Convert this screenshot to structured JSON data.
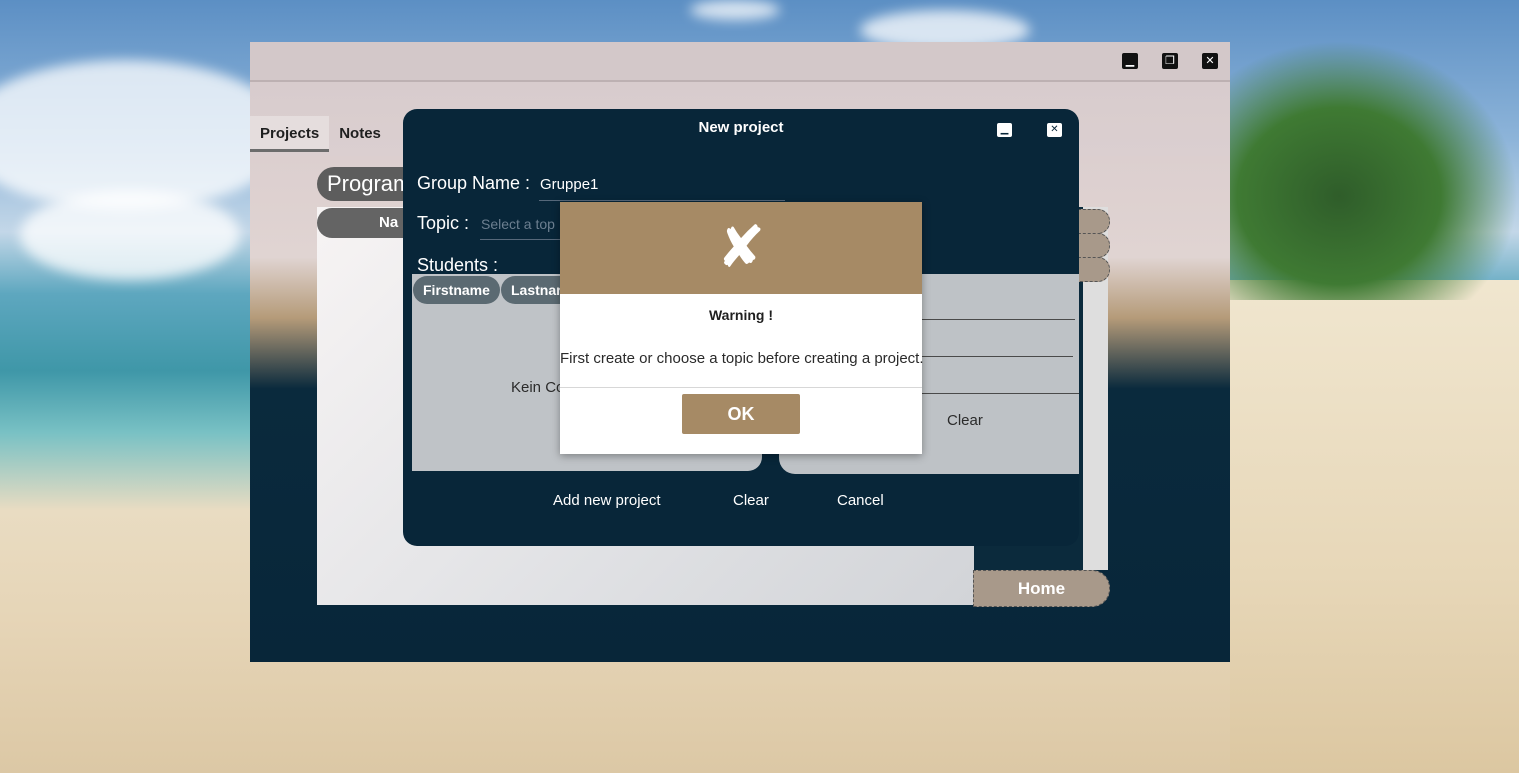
{
  "app": {
    "tabs": [
      {
        "label": "Projects",
        "active": true
      },
      {
        "label": "Notes",
        "active": false
      }
    ],
    "page_title": "Program",
    "column_header": "Na",
    "home_button": "Home",
    "window_controls": {
      "minimize": "minimize-icon",
      "restore": "restore-icon",
      "close": "close-icon"
    }
  },
  "new_project_dialog": {
    "title": "New project",
    "group_name_label": "Group Name :",
    "group_name_value": "Gruppe1",
    "topic_label": "Topic :",
    "topic_placeholder": "Select a top",
    "students_label": "Students :",
    "students_columns": [
      "Firstname",
      "Lastnar"
    ],
    "students_empty": "Kein Co",
    "selected_clear": "Clear",
    "add_button": "Add new project",
    "clear_button": "Clear",
    "cancel_button": "Cancel"
  },
  "warning_dialog": {
    "icon": "cross-icon",
    "title": "Warning !",
    "message": "First create or choose a topic before creating a project.",
    "ok_button": "OK"
  },
  "colors": {
    "dark_navy": "#082639",
    "accent_tan": "#a68a65",
    "titlebar": "#d3c8c9"
  }
}
